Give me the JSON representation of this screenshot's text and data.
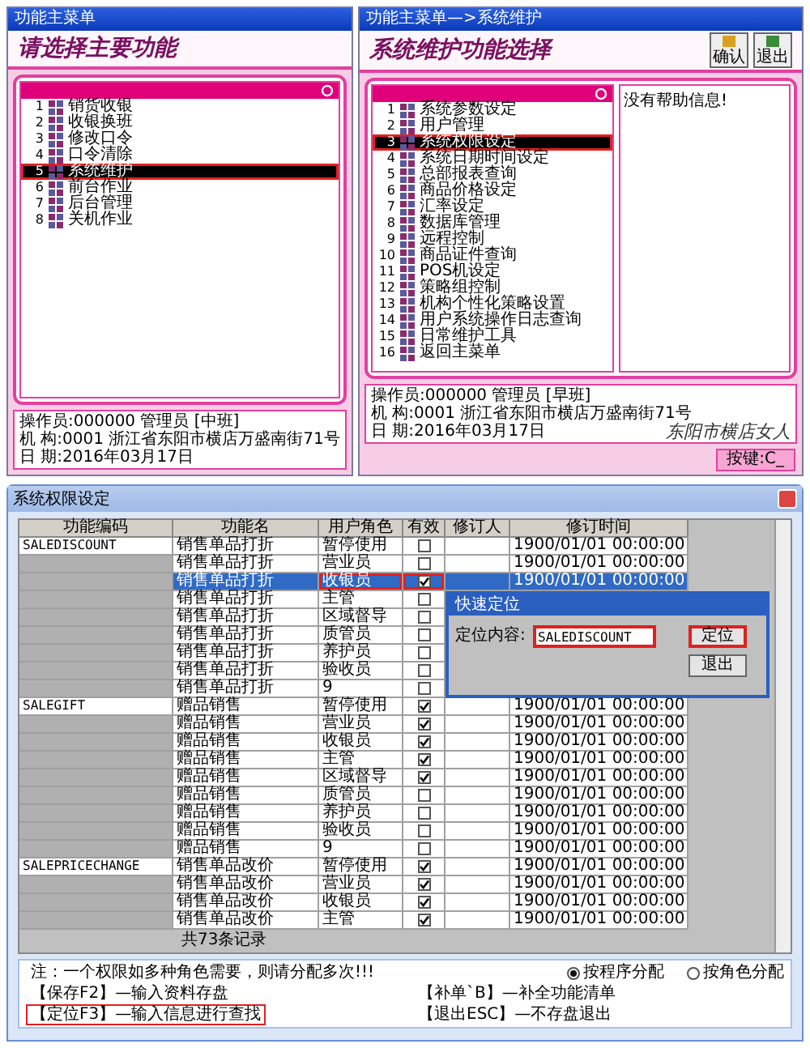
{
  "main_menu": {
    "title": "功能主菜单",
    "heading": "请选择主要功能",
    "items": [
      {
        "number": "1",
        "label": "销货收银",
        "selected": false,
        "marked": false
      },
      {
        "number": "2",
        "label": "收银换班",
        "selected": false,
        "marked": false
      },
      {
        "number": "3",
        "label": "修改口令",
        "selected": false,
        "marked": false
      },
      {
        "number": "4",
        "label": "口令清除",
        "selected": false,
        "marked": false
      },
      {
        "number": "5",
        "label": "系统维护",
        "selected": true,
        "marked": true
      },
      {
        "number": "6",
        "label": "前台作业",
        "selected": false,
        "marked": false
      },
      {
        "number": "7",
        "label": "后台管理",
        "selected": false,
        "marked": false
      },
      {
        "number": "8",
        "label": "关机作业",
        "selected": false,
        "marked": false
      }
    ],
    "footer": [
      "操作员:000000 管理员 [中班]",
      "机 构:0001 浙江省东阳市横店万盛南街71号",
      "日 期:2016年03月17日"
    ]
  },
  "maintenance_menu": {
    "title": "功能主菜单—>系统维护",
    "heading": "系统维护功能选择",
    "buttons": [
      "确认",
      "退出"
    ],
    "items": [
      {
        "number": "1",
        "label": "系统参数设定",
        "selected": false,
        "marked": false
      },
      {
        "number": "2",
        "label": "用户管理",
        "selected": false,
        "marked": false
      },
      {
        "number": "3",
        "label": "系统权限设定",
        "selected": true,
        "marked": true
      },
      {
        "number": "4",
        "label": "系统日期时间设定",
        "selected": false,
        "marked": false
      },
      {
        "number": "5",
        "label": "总部报表查询",
        "selected": false,
        "marked": false
      },
      {
        "number": "6",
        "label": "商品价格设定",
        "selected": false,
        "marked": false
      },
      {
        "number": "7",
        "label": "汇率设定",
        "selected": false,
        "marked": false
      },
      {
        "number": "8",
        "label": "数据库管理",
        "selected": false,
        "marked": false
      },
      {
        "number": "9",
        "label": "远程控制",
        "selected": false,
        "marked": false
      },
      {
        "number": "10",
        "label": "商品证件查询",
        "selected": false,
        "marked": false
      },
      {
        "number": "11",
        "label": "POS机设定",
        "selected": false,
        "marked": false
      },
      {
        "number": "12",
        "label": "策略组控制",
        "selected": false,
        "marked": false
      },
      {
        "number": "13",
        "label": "机构个性化策略设置",
        "selected": false,
        "marked": false
      },
      {
        "number": "14",
        "label": "用户系统操作日志查询",
        "selected": false,
        "marked": false
      },
      {
        "number": "15",
        "label": "日常维护工具",
        "selected": false,
        "marked": false
      },
      {
        "number": "16",
        "label": "返回主菜单",
        "selected": false,
        "marked": false
      }
    ],
    "help": "没有帮助信息!",
    "footer": [
      "操作员:000000 管理员 [早班]",
      "机 构:0001 浙江省东阳市横店万盛南街71号",
      "日 期:2016年03月17日"
    ],
    "signature": "东阳市横店女人",
    "key_hint": "按键:C_"
  },
  "permissions": {
    "title": "系统权限设定",
    "columns": [
      "功能编码",
      "功能名",
      "用户角色",
      "有效",
      "修订人",
      "修订时间"
    ],
    "groups": [
      {
        "code": "SALEDISCOUNT",
        "rows": [
          {
            "name": "销售单品打折",
            "role": "暂停使用",
            "valid": false,
            "time": "1900/01/01 00:00:00",
            "selected": false,
            "marked": false
          },
          {
            "name": "销售单品打折",
            "role": "营业员",
            "valid": false,
            "time": "1900/01/01 00:00:00",
            "selected": false,
            "marked": false
          },
          {
            "name": "销售单品打折",
            "role": "收银员",
            "valid": true,
            "time": "1900/01/01 00:00:00",
            "selected": true,
            "marked": true
          },
          {
            "name": "销售单品打折",
            "role": "主管",
            "valid": false,
            "selected": false,
            "marked": false
          },
          {
            "name": "销售单品打折",
            "role": "区域督导",
            "valid": false,
            "selected": false,
            "marked": false
          },
          {
            "name": "销售单品打折",
            "role": "质管员",
            "valid": false,
            "selected": false,
            "marked": false
          },
          {
            "name": "销售单品打折",
            "role": "养护员",
            "valid": false,
            "selected": false,
            "marked": false
          },
          {
            "name": "销售单品打折",
            "role": "验收员",
            "valid": false,
            "selected": false,
            "marked": false
          },
          {
            "name": "销售单品打折",
            "role": "9",
            "valid": false,
            "selected": false,
            "marked": false
          }
        ]
      },
      {
        "code": "SALEGIFT",
        "rows": [
          {
            "name": "赠品销售",
            "role": "暂停使用",
            "valid": true,
            "time": "1900/01/01 00:00:00",
            "selected": false,
            "marked": false
          },
          {
            "name": "赠品销售",
            "role": "营业员",
            "valid": true,
            "time": "1900/01/01 00:00:00",
            "selected": false,
            "marked": false
          },
          {
            "name": "赠品销售",
            "role": "收银员",
            "valid": true,
            "time": "1900/01/01 00:00:00",
            "selected": false,
            "marked": false
          },
          {
            "name": "赠品销售",
            "role": "主管",
            "valid": true,
            "time": "1900/01/01 00:00:00",
            "selected": false,
            "marked": false
          },
          {
            "name": "赠品销售",
            "role": "区域督导",
            "valid": true,
            "time": "1900/01/01 00:00:00",
            "selected": false,
            "marked": false
          },
          {
            "name": "赠品销售",
            "role": "质管员",
            "valid": false,
            "time": "1900/01/01 00:00:00",
            "selected": false,
            "marked": false
          },
          {
            "name": "赠品销售",
            "role": "养护员",
            "valid": false,
            "time": "1900/01/01 00:00:00",
            "selected": false,
            "marked": false
          },
          {
            "name": "赠品销售",
            "role": "验收员",
            "valid": false,
            "time": "1900/01/01 00:00:00",
            "selected": false,
            "marked": false
          },
          {
            "name": "赠品销售",
            "role": "9",
            "valid": false,
            "time": "1900/01/01 00:00:00",
            "selected": false,
            "marked": false
          }
        ]
      },
      {
        "code": "SALEPRICECHANGE",
        "rows": [
          {
            "name": "销售单品改价",
            "role": "暂停使用",
            "valid": true,
            "time": "1900/01/01 00:00:00",
            "selected": false,
            "marked": false
          },
          {
            "name": "销售单品改价",
            "role": "营业员",
            "valid": true,
            "time": "1900/01/01 00:00:00",
            "selected": false,
            "marked": false
          },
          {
            "name": "销售单品改价",
            "role": "收银员",
            "valid": true,
            "time": "1900/01/01 00:00:00",
            "selected": false,
            "marked": false
          },
          {
            "name": "销售单品改价",
            "role": "主管",
            "valid": true,
            "time": "1900/01/01 00:00:00",
            "selected": false,
            "marked": false
          }
        ]
      }
    ],
    "total": "共73条记录",
    "note": "注：一个权限如多种角色需要，则请分配多次!!!",
    "shortcuts": [
      {
        "text": "【保存F2】—输入资料存盘",
        "marked": false
      },
      {
        "text": "【补单`B】—补全功能清单",
        "marked": false
      },
      {
        "text": "【定位F3】—输入信息进行查找",
        "marked": true
      },
      {
        "text": "【退出ESC】—不存盘退出",
        "marked": false
      }
    ],
    "allocation": [
      {
        "label": "按程序分配",
        "selected": true
      },
      {
        "label": "按角色分配",
        "selected": false
      }
    ],
    "dialog": {
      "title": "快速定位",
      "label": "定位内容:",
      "value": "SALEDISCOUNT",
      "marked": true,
      "buttons": [
        {
          "label": "定位",
          "marked": true
        },
        {
          "label": "退出",
          "marked": false
        }
      ]
    }
  }
}
